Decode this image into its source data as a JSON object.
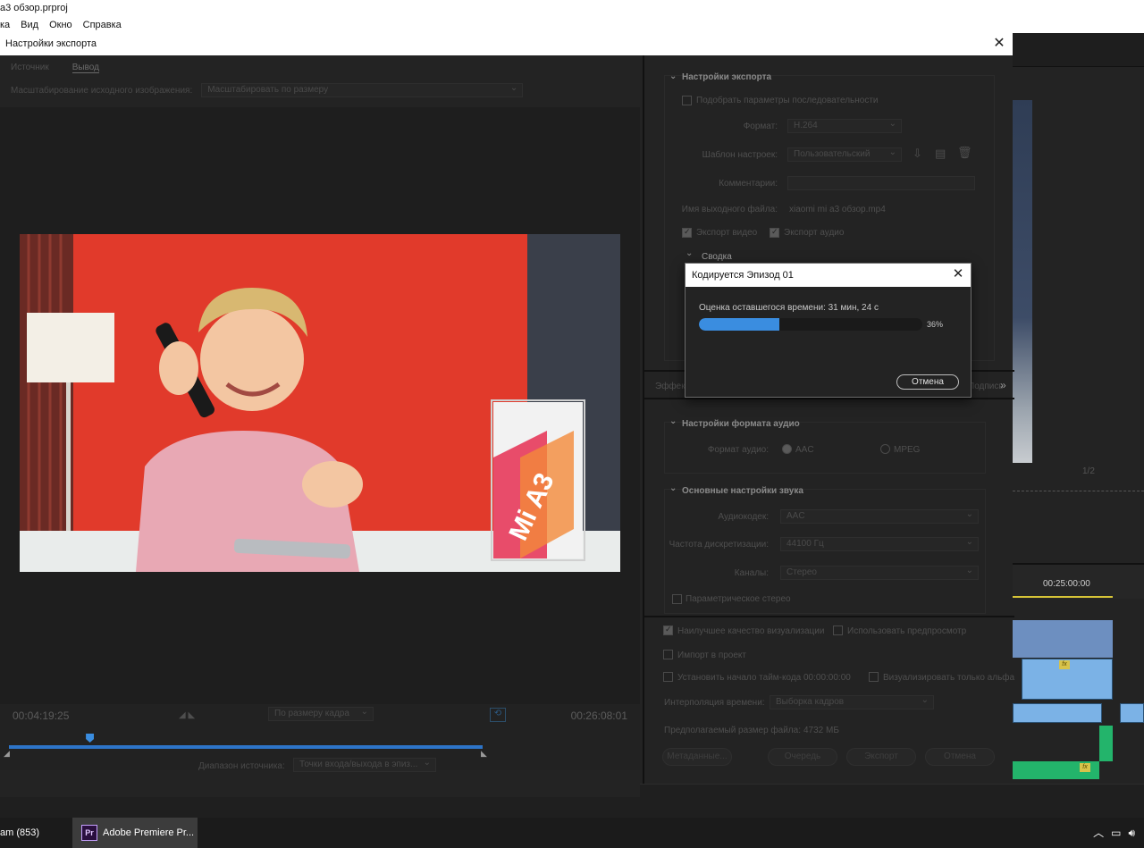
{
  "app": {
    "title": "a3 обзор.prproj",
    "menu": [
      "ка",
      "Вид",
      "Окно",
      "Справка"
    ],
    "timecode": "00:25:00:00",
    "page_fraction": "1/2"
  },
  "export_dialog": {
    "title": "Настройки экспорта",
    "source_tabs": [
      "Источник",
      "Вывод"
    ],
    "active_tab": "Вывод",
    "scaling_label": "Масштабирование исходного изображения:",
    "scaling_value": "Масштабировать по размеру",
    "timecode_in": "00:04:19:25",
    "timecode_out": "00:26:08:01",
    "fit_value": "По размеру кадра",
    "range_label": "Диапазон источника:",
    "range_value": "Точки входа/выхода в эпиз...",
    "range_playhead_fraction": 0.17
  },
  "export_settings": {
    "title": "Настройки экспорта",
    "match_sequence": "Подобрать параметры последовательности",
    "format_label": "Формат:",
    "format_value": "H.264",
    "preset_label": "Шаблон настроек:",
    "preset_value": "Пользовательский",
    "comments_label": "Комментарии:",
    "output_label": "Имя выходного файла:",
    "output_value": "xiaomi mi a3 обзор.mp4",
    "export_video": "Экспорт видео",
    "export_audio": "Экспорт аудио",
    "summary_title": "Сводка"
  },
  "tabs_row": {
    "left": "Эффект",
    "right": "Подпись",
    "more": "»"
  },
  "audio_format": {
    "title": "Настройки формата аудио",
    "label": "Формат аудио:",
    "options": [
      "AAC",
      "MPEG"
    ],
    "selected": "AAC"
  },
  "audio_basic": {
    "title": "Основные настройки звука",
    "codec_label": "Аудиокодек:",
    "codec_value": "AAC",
    "rate_label": "Частота дискретизации:",
    "rate_value": "44100 Гц",
    "channels_label": "Каналы:",
    "channels_value": "Стерео",
    "param_stereo": "Параметрическое стерео"
  },
  "bottom_options": {
    "best_quality": "Наилучшее качество визуализации",
    "use_previews": "Использовать предпросмотр",
    "import_project": "Импорт в проект",
    "set_start_tc": "Установить начало тайм-кода",
    "start_tc_value": "00:00:00:00",
    "render_alpha": "Визуализировать только альфа",
    "time_interp_label": "Интерполяция времени:",
    "time_interp_value": "Выборка кадров",
    "file_size_label": "Предполагаемый размер файла:",
    "file_size_value": "4732 МБ",
    "buttons": {
      "metadata": "Метаданные...",
      "queue": "Очередь",
      "export": "Экспорт",
      "cancel": "Отмена"
    }
  },
  "encoding": {
    "title": "Кодируется Эпизод 01",
    "status": "Оценка оставшегося времени: 31 мин, 24 с",
    "progress": 36,
    "progress_label": "36%",
    "cancel": "Отмена"
  },
  "taskbar": {
    "steam": "am (853)",
    "premiere_icon": "Pr",
    "premiere": "Adobe Premiere Pr..."
  },
  "colors": {
    "accent": "#3a8de0",
    "timeline_blue": "#2d74c8",
    "clip_green": "#23b46b",
    "fx_yellow": "#d8c34a"
  }
}
